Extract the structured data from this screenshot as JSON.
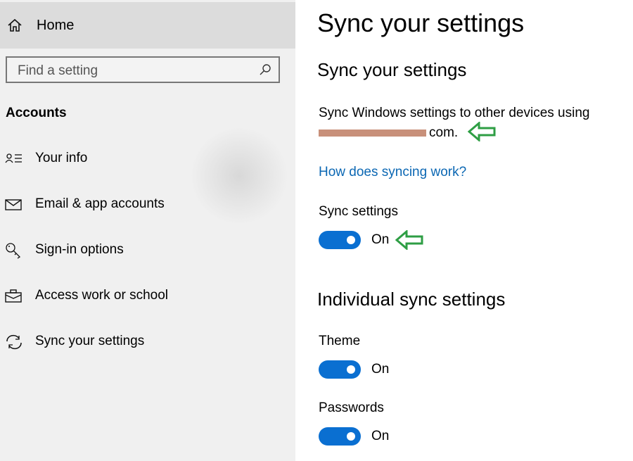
{
  "sidebar": {
    "home_label": "Home",
    "search_placeholder": "Find a setting",
    "section_title": "Accounts",
    "items": [
      {
        "label": "Your info",
        "icon": "person-list-icon"
      },
      {
        "label": "Email & app accounts",
        "icon": "mail-icon"
      },
      {
        "label": "Sign-in options",
        "icon": "key-icon"
      },
      {
        "label": "Access work or school",
        "icon": "briefcase-icon"
      },
      {
        "label": "Sync your settings",
        "icon": "sync-icon"
      }
    ]
  },
  "main": {
    "page_title": "Sync your settings",
    "section_title": "Sync your settings",
    "description": "Sync Windows settings to other devices using",
    "email_suffix": "com.",
    "help_link": "How does syncing work?",
    "sync_settings": {
      "label": "Sync settings",
      "state": "On"
    },
    "individual_title": "Individual sync settings",
    "individual": [
      {
        "label": "Theme",
        "state": "On"
      },
      {
        "label": "Passwords",
        "state": "On"
      }
    ]
  },
  "colors": {
    "accent": "#0a6fd1",
    "link": "#0b67b3",
    "annotation_arrow": "#2e9e44",
    "redaction": "#c8907a"
  }
}
